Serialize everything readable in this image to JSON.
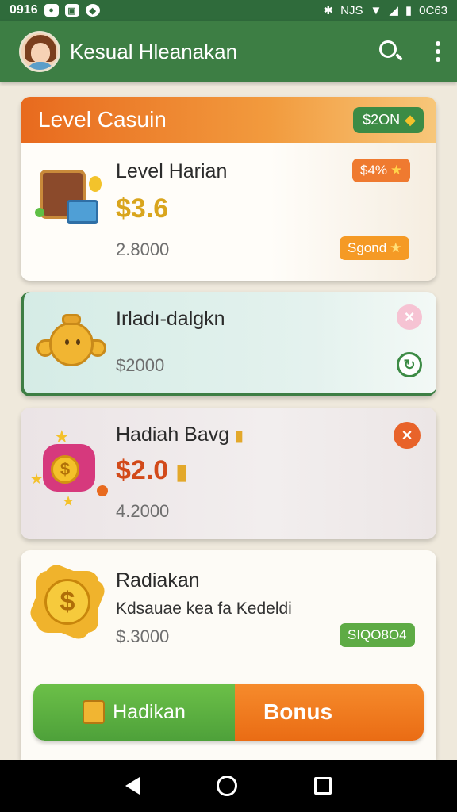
{
  "status_bar": {
    "time": "0916",
    "right_time": "0C63",
    "signal_text": "NJS"
  },
  "app_bar": {
    "title": "Kesual Hleanakan"
  },
  "cards": [
    {
      "header_title": "Level Casuin",
      "header_badge": "$2ON",
      "name": "Level Harian",
      "price": "$3.6",
      "sub": "2.8000",
      "badge_top": "$4%",
      "badge_bottom": "Sgond",
      "colors": {
        "header": "#e86a1e",
        "badge_top": "#ef7a30",
        "badge_bottom": "#f59a25",
        "price": "#d9a51d"
      }
    },
    {
      "name": "Irladı-dalgkn",
      "sub": "$2000",
      "colors": {
        "accent": "#3d7e44"
      }
    },
    {
      "name": "Hadiah Bavg",
      "price": "$2.0",
      "sub": "4.2000",
      "colors": {
        "price": "#d24a1a"
      }
    },
    {
      "name": "Radiakan",
      "description": "Kdsauae kea fa Kedeldi",
      "sub": "$.3000",
      "pill": "SIQO8O4",
      "colors": {
        "pill": "#5eab45"
      }
    }
  ],
  "cta": {
    "left_label": "Hadikan",
    "right_label": "Bonus"
  },
  "icons": {
    "search": "search-icon",
    "more": "more-vert-icon",
    "close": "close-icon",
    "refresh": "refresh-icon",
    "back": "back-icon",
    "home": "home-icon",
    "recent": "recent-apps-icon"
  }
}
